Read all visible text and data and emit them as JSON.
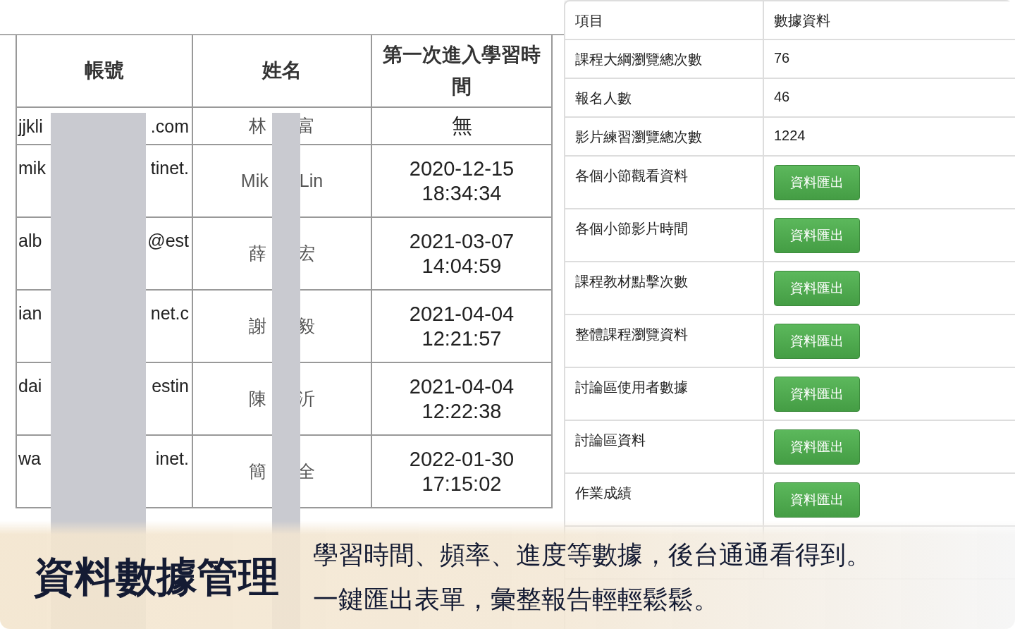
{
  "account_table": {
    "columns": [
      "帳號",
      "姓名",
      "第一次進入學習時間"
    ],
    "rows": [
      {
        "account_start": "jjkli",
        "account_end": ".com",
        "name_start": "林",
        "name_end": "富",
        "first_entry": [
          "無"
        ]
      },
      {
        "account_start": "mik",
        "account_end": "tinet.",
        "name_start": "Mik",
        "name_end": "Lin",
        "first_entry": [
          "2020-12-15",
          "18:34:34"
        ]
      },
      {
        "account_start": "alb",
        "account_end": "@est",
        "name_start": "薛",
        "name_end": "宏",
        "first_entry": [
          "2021-03-07",
          "14:04:59"
        ]
      },
      {
        "account_start": "ian",
        "account_end": "net.c",
        "name_start": "謝",
        "name_end": "毅",
        "first_entry": [
          "2021-04-04",
          "12:21:57"
        ]
      },
      {
        "account_start": "dai",
        "account_end": "estin",
        "name_start": "陳",
        "name_end": "沂",
        "first_entry": [
          "2021-04-04",
          "12:22:38"
        ]
      },
      {
        "account_start": "wa",
        "account_end": "inet.",
        "name_start": "簡",
        "name_end": "全",
        "first_entry": [
          "2022-01-30",
          "17:15:02"
        ]
      }
    ]
  },
  "stats_table": {
    "columns": [
      "項目",
      "數據資料"
    ],
    "rows": [
      {
        "item": "課程大綱瀏覽總次數",
        "kind": "value",
        "value": "76"
      },
      {
        "item": "報名人數",
        "kind": "value",
        "value": "46"
      },
      {
        "item": "影片練習瀏覽總次數",
        "kind": "value",
        "value": "1224"
      },
      {
        "item": "各個小節觀看資料",
        "kind": "button",
        "value": "資料匯出"
      },
      {
        "item": "各個小節影片時間",
        "kind": "button",
        "value": "資料匯出"
      },
      {
        "item": "課程教材點擊次數",
        "kind": "button",
        "value": "資料匯出"
      },
      {
        "item": "整體課程瀏覽資料",
        "kind": "button",
        "value": "資料匯出"
      },
      {
        "item": "討論區使用者數據",
        "kind": "button",
        "value": "資料匯出"
      },
      {
        "item": "討論區資料",
        "kind": "button",
        "value": "資料匯出"
      },
      {
        "item": "作業成績",
        "kind": "button",
        "value": "資料匯出"
      }
    ]
  },
  "caption": {
    "title": "資料數據管理",
    "lines": [
      "學習時間、頻率、進度等數據，後台通通看得到。",
      "一鍵匯出表單，彙整報告輕輕鬆鬆。"
    ]
  }
}
